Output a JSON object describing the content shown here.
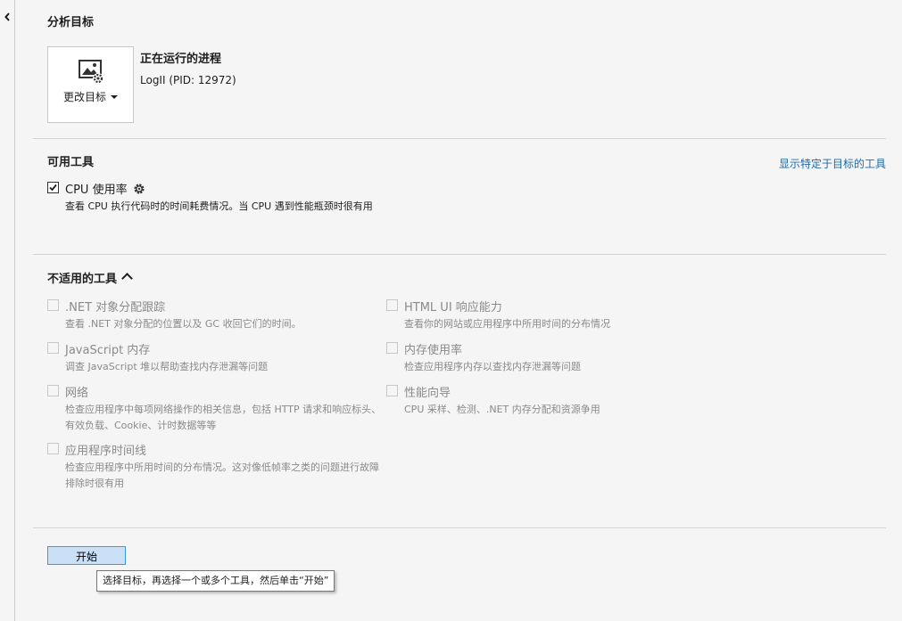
{
  "target_section": {
    "title": "分析目标",
    "change_target_label": "更改目标",
    "process_title": "正在运行的进程",
    "process_name": "LogII (PID: 12972)"
  },
  "available_tools": {
    "title": "可用工具",
    "show_specific_link": "显示特定于目标的工具",
    "tools": [
      {
        "name": "CPU 使用率",
        "desc": "查看 CPU 执行代码时的时间耗费情况。当 CPU 遇到性能瓶颈时很有用",
        "checked": true
      }
    ]
  },
  "unavailable_tools": {
    "title": "不适用的工具",
    "left": [
      {
        "name": ".NET 对象分配跟踪",
        "desc": "查看 .NET 对象分配的位置以及 GC 收回它们的时间。"
      },
      {
        "name": "JavaScript 内存",
        "desc": "调查 JavaScript 堆以帮助查找内存泄漏等问题"
      },
      {
        "name": "网络",
        "desc": "检查应用程序中每项网络操作的相关信息，包括 HTTP 请求和响应标头、有效负载、Cookie、计时数据等等"
      },
      {
        "name": "应用程序时间线",
        "desc": "检查应用程序中所用时间的分布情况。这对像低帧率之类的问题进行故障排除时很有用"
      }
    ],
    "right": [
      {
        "name": "HTML UI 响应能力",
        "desc": "查看你的网站或应用程序中所用时间的分布情况"
      },
      {
        "name": "内存使用率",
        "desc": "检查应用程序内存以查找内存泄漏等问题"
      },
      {
        "name": "性能向导",
        "desc": "CPU 采样、检测、.NET 内存分配和资源争用"
      }
    ]
  },
  "start_button_label": "开始",
  "tooltip_text": "选择目标，再选择一个或多个工具，然后单击“开始”",
  "colors": {
    "link": "#1e6aa8",
    "button_bg": "#c9e0f7",
    "button_border": "#3399ff"
  }
}
